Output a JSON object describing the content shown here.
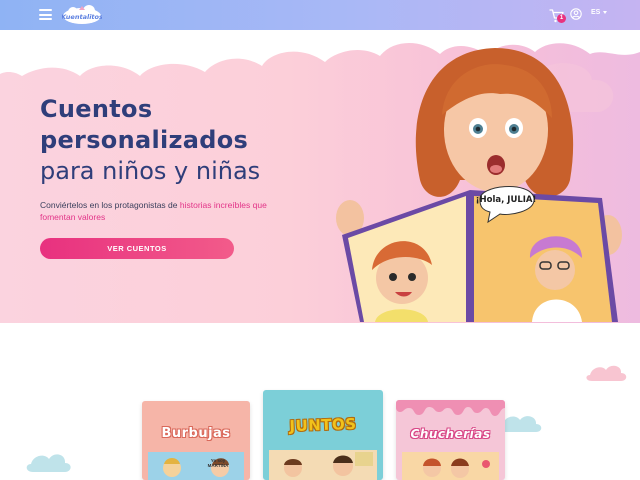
{
  "header": {
    "menu_icon": "hamburger-menu-icon",
    "logo_text": "Kuentalitos",
    "cart_icon": "shopping-cart-icon",
    "cart_count": "1",
    "user_icon": "user-account-icon",
    "language": "ES",
    "colors": {
      "gradient_start": "#8fb3f4",
      "gradient_end": "#c5b4f2"
    }
  },
  "hero": {
    "title_line1": "Cuentos",
    "title_line2": "personalizados",
    "title_line3": "para niños y niñas",
    "subtitle_prefix": "Conviértelos en los protagonistas de ",
    "subtitle_highlight": "historias increíbles que fomentan valores",
    "cta_label": "VER CUENTOS",
    "speech_bubble": "¡Hola, JULIA!",
    "colors": {
      "title": "#2f3e7a",
      "highlight": "#e23488",
      "cta": "#e8317f"
    }
  },
  "books": [
    {
      "title": "Burbujas",
      "caption": "Yo soy MARTINA",
      "cover_color": "#f6b5a8"
    },
    {
      "title": "JUNTOS",
      "cover_color": "#7ccfd8"
    },
    {
      "title": "Chucherías",
      "cover_color": "#f5c6d7"
    }
  ]
}
